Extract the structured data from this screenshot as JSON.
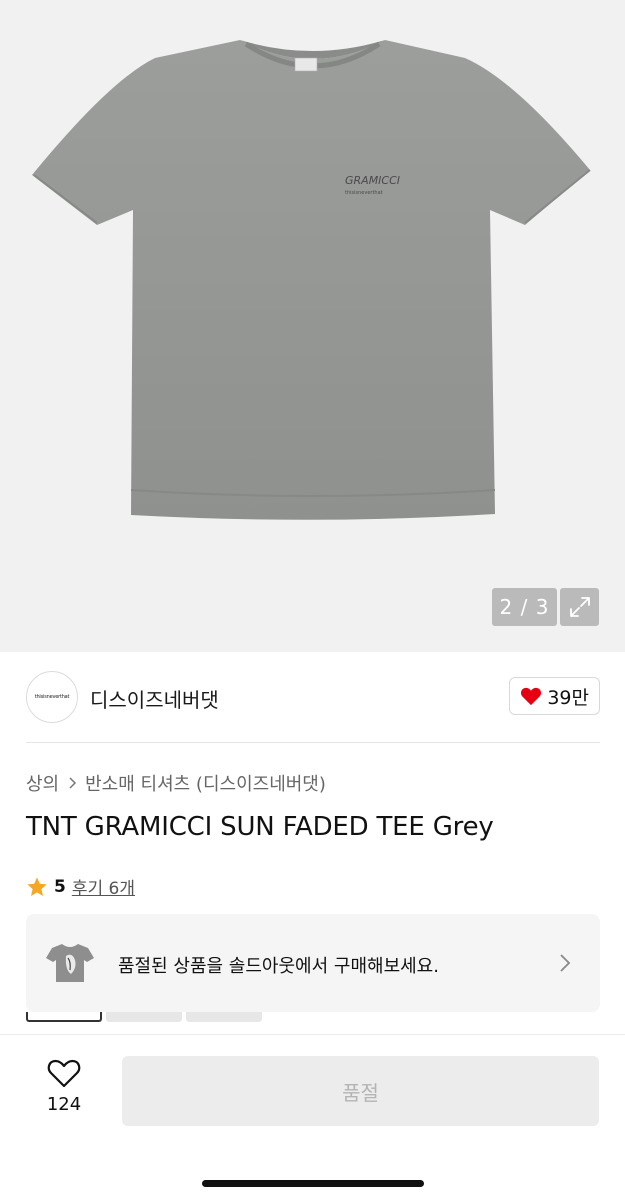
{
  "gallery": {
    "pager": "2 / 3",
    "print_brand": "GRAMICCI",
    "print_sub": "thisisneverthat"
  },
  "shop": {
    "logo_text": "thisisneverthat",
    "name": "디스이즈네버댓",
    "likes": "39만",
    "heart_color": "#e60012"
  },
  "breadcrumb": {
    "category": "상의",
    "subcategory": "반소매 티셔츠 (디스이즈네버댓)"
  },
  "product": {
    "title": "TNT GRAMICCI SUN FADED TEE Grey",
    "rating": "5",
    "review_label": "후기 6개",
    "star_color": "#f5a623"
  },
  "soldout_banner": {
    "message": "품절된 상품을 솔드아웃에서 구매해보세요."
  },
  "bottom_bar": {
    "wish_count": "124",
    "buy_label": "품절"
  }
}
